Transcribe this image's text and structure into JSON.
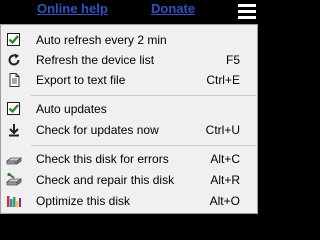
{
  "topbar": {
    "online_help": "Online help",
    "donate": "Donate",
    "link_color": "#2f52c8",
    "menu_icon": "hamburger-icon"
  },
  "menu": {
    "items": [
      {
        "label": "Auto refresh every 2 min",
        "shortcut": "",
        "icon": "checkbox-checked-icon",
        "checked": true
      },
      {
        "label": "Refresh the device list",
        "shortcut": "F5",
        "icon": "refresh-icon"
      },
      {
        "label": "Export to text file",
        "shortcut": "Ctrl+E",
        "icon": "document-icon"
      },
      {
        "label": "Auto updates",
        "shortcut": "",
        "icon": "checkbox-checked-icon",
        "checked": true
      },
      {
        "label": "Check for updates now",
        "shortcut": "Ctrl+U",
        "icon": "download-icon"
      },
      {
        "label": "Check this disk for errors",
        "shortcut": "Alt+C",
        "icon": "disk-check-icon"
      },
      {
        "label": "Check and repair this disk",
        "shortcut": "Alt+R",
        "icon": "disk-repair-icon"
      },
      {
        "label": "Optimize this disk",
        "shortcut": "Alt+O",
        "icon": "disk-optimize-icon"
      }
    ]
  }
}
